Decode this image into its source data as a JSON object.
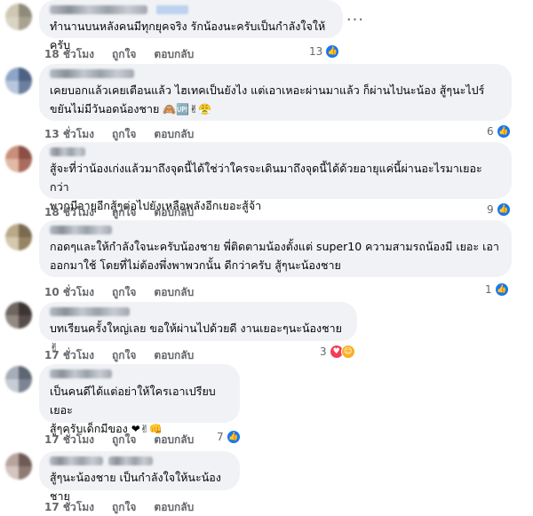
{
  "comments": [
    {
      "text": "ทำนานบนหลังคนมีทุกยุคจริง รักน้องนะครับเป็นกำลังใจให้ครับ",
      "time": "18 ชั่วโมง",
      "like": "ถูกใจ",
      "reply": "ตอบกลับ",
      "count": "13",
      "avatar_colors": [
        "#cfc7b4",
        "#8f8a7a",
        "#d9d3c4",
        "#a9a290"
      ]
    },
    {
      "text": "เคยบอกแล้วเคยเตือนแล้ว ไฮเทคเป็นยังไง แต่เอาเหอะผ่านมาแล้ว ก็ผ่านไปนะน้อง สู้ๆนะไปร์\nขยันไม่มีวันอดน้องชาย",
      "emoji": "🙈🆙✌😤",
      "time": "13 ชั่วโมง",
      "like": "ถูกใจ",
      "reply": "ตอบกลับ",
      "count": "6",
      "avatar_colors": [
        "#8da5c8",
        "#4d6284",
        "#b8c7dc",
        "#6b7f9f"
      ]
    },
    {
      "text": "สู้จะที่ว่าน้องเก่งแล้วมาถึงจุดนี้ได้ใช่ว่าใครจะเดินมาถึงจุดนี้ได้ด้วยอายุแค่นี้ผ่านอะไรมาเยอะกว่า\nพวกมีอายุอีกสู้ๆต่อไปยังเหลือพลังอีกเยอะสู้จ้า",
      "time": "18 ชั่วโมง",
      "like": "ถูกใจ",
      "reply": "ตอบกลับ",
      "count": "9",
      "avatar_colors": [
        "#c98f7b",
        "#8c4f45",
        "#e2b8a6",
        "#a86c5d"
      ]
    },
    {
      "text": "กอดๆและให้กำลังใจนะครับน้องชาย พี่ติดตามน้องตั้งแต่ super10 ความสามรถน้องมี เยอะ เอา\nออกมาใช้ โดยที่ไม่ต้องพึ่งพาพวกนั้น ดีกว่าครับ สู้ๆนะน้องชาย",
      "time": "10 ชั่วโมง",
      "like": "ถูกใจ",
      "reply": "ตอบกลับ",
      "count": "1",
      "avatar_colors": [
        "#b9a98a",
        "#7a6a4f",
        "#d6c8ad",
        "#968563"
      ]
    },
    {
      "text": "บทเรียนครั้งใหญ่เลย ขอให้ผ่านไปด้วยดี งานเยอะๆนะน้องชาย",
      "emoji": "✌",
      "time": "17 ชั่วโมง",
      "like": "ถูกใจ",
      "reply": "ตอบกลับ",
      "count": "3",
      "avatar_colors": [
        "#6f6661",
        "#3d3532",
        "#948a84",
        "#574e4a"
      ]
    },
    {
      "text": "เป็นคนดีได้แต่อย่าให้ใครเอาเปรียบเยอะ\nสู้ๆครับเด็กมีของ",
      "emoji": "❤✌👊",
      "time": "17 ชั่วโมง",
      "like": "ถูกใจ",
      "reply": "ตอบกลับ",
      "count": "7",
      "avatar_colors": [
        "#a6adb8",
        "#5f6673",
        "#c7ccd4",
        "#7d8592"
      ]
    },
    {
      "text": "สู้ๆนะน้องชาย เป็นกำลังใจให้นะน้องชาย",
      "time": "17 ชั่วโมง",
      "like": "ถูกใจ",
      "reply": "ตอบกลับ",
      "avatar_colors": [
        "#b8a49e",
        "#6e5b56",
        "#d4c5c0",
        "#8f7a74"
      ]
    }
  ],
  "more_icon": "ellipsis-icon",
  "colors": {
    "like_blue": "#1877f2",
    "bubble": "#f0f2f5",
    "meta": "#65676b"
  }
}
